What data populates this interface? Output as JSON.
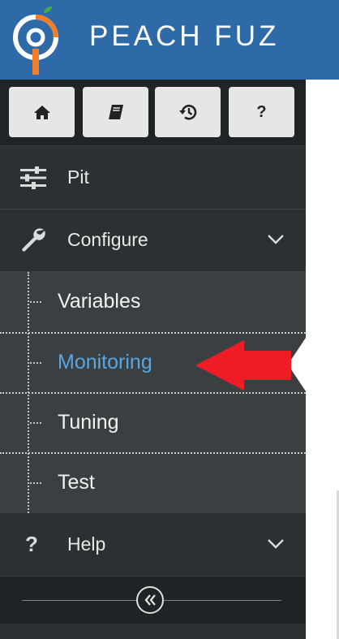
{
  "header": {
    "brand": "PEACH FUZ",
    "logo_icon": "peach-logo-icon"
  },
  "toolbar": [
    {
      "icon": "home-icon"
    },
    {
      "icon": "book-icon"
    },
    {
      "icon": "history-icon"
    },
    {
      "icon": "question-icon",
      "label": "?"
    }
  ],
  "nav": {
    "pit": {
      "label": "Pit",
      "icon": "sliders-icon"
    },
    "configure": {
      "label": "Configure",
      "icon": "wrench-icon",
      "expanded": true
    },
    "help": {
      "label": "Help",
      "icon": "question-icon",
      "glyph": "?"
    }
  },
  "submenu": [
    {
      "label": "Variables",
      "active": false
    },
    {
      "label": "Monitoring",
      "active": true
    },
    {
      "label": "Tuning",
      "active": false
    },
    {
      "label": "Test",
      "active": false
    }
  ],
  "collapse": {
    "icon": "double-chevron-left-icon",
    "glyph": "«"
  },
  "colors": {
    "header": "#2f6aa8",
    "sidebar": "#2b3133",
    "submenu": "#3a4042",
    "active_link": "#58a6e6",
    "arrow": "#ee1c25"
  }
}
